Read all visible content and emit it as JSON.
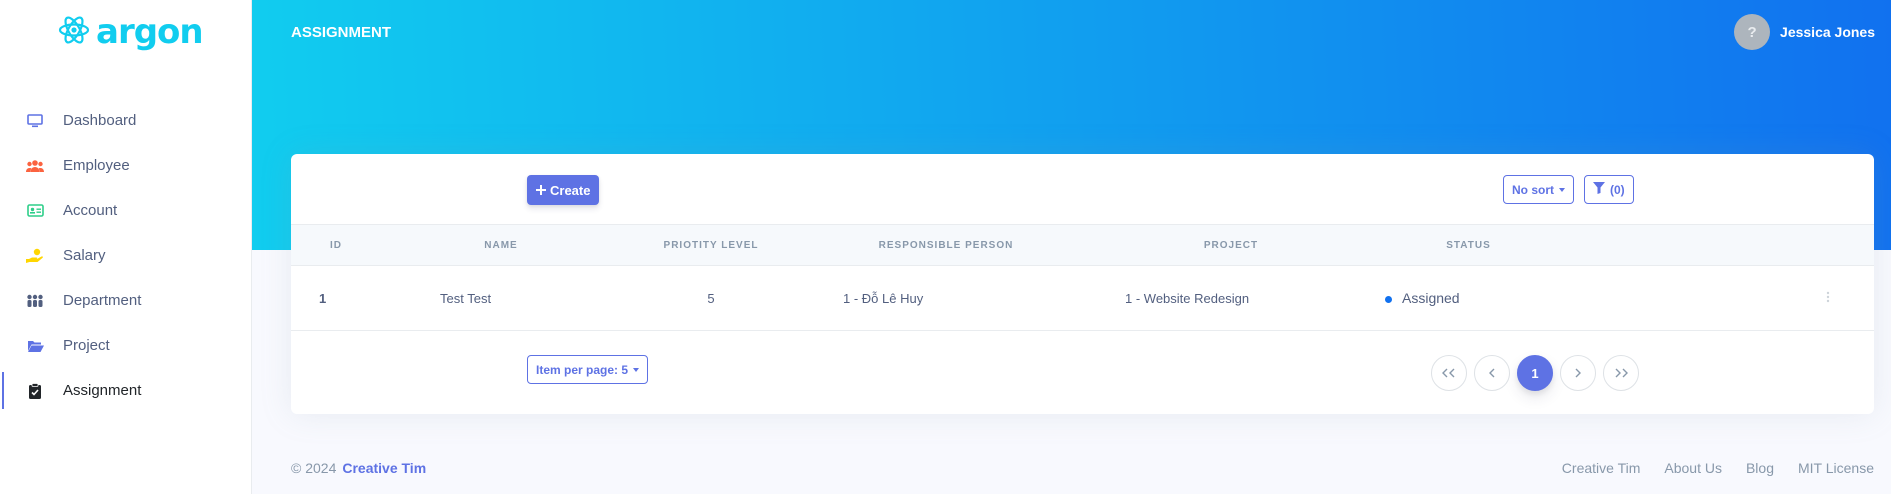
{
  "brand": {
    "name": "argon"
  },
  "sidebar": {
    "items": [
      {
        "label": "Dashboard",
        "icon": "monitor-icon",
        "color": "#5e72e4"
      },
      {
        "label": "Employee",
        "icon": "users-icon",
        "color": "#fb6340"
      },
      {
        "label": "Account",
        "icon": "id-card-icon",
        "color": "#2dce89"
      },
      {
        "label": "Salary",
        "icon": "hand-coin-icon",
        "color": "#ffd600"
      },
      {
        "label": "Department",
        "icon": "group-icon",
        "color": "#525f7f"
      },
      {
        "label": "Project",
        "icon": "folder-open-icon",
        "color": "#5e72e4"
      },
      {
        "label": "Assignment",
        "icon": "clipboard-check-icon",
        "color": "#212529"
      }
    ]
  },
  "header": {
    "title": "ASSIGNMENT",
    "user_name": "Jessica Jones",
    "avatar_glyph": "?"
  },
  "toolbar": {
    "create_label": "Create",
    "sort_label": "No sort",
    "filter_label": "(0)"
  },
  "table": {
    "columns": [
      "ID",
      "NAME",
      "PRIOTITY LEVEL",
      "RESPONSIBLE PERSON",
      "PROJECT",
      "STATUS"
    ],
    "rows": [
      {
        "id": "1",
        "name": "Test Test",
        "priority": "5",
        "responsible": "1 - Đỗ Lê Huy",
        "project": "1 - Website Redesign",
        "status": "Assigned"
      }
    ]
  },
  "pagination": {
    "per_page_label": "Item per page: 5",
    "first": "<<",
    "prev": "<",
    "current": "1",
    "next": ">",
    "last": ">>"
  },
  "footer": {
    "copyright": "© 2024",
    "brand": "Creative Tim",
    "links": [
      "Creative Tim",
      "About Us",
      "Blog",
      "MIT License"
    ]
  },
  "colors": {
    "primary": "#5e72e4",
    "gradient_start": "#11cdef",
    "gradient_end": "#1171ef",
    "status_dot": "#1171ef"
  }
}
